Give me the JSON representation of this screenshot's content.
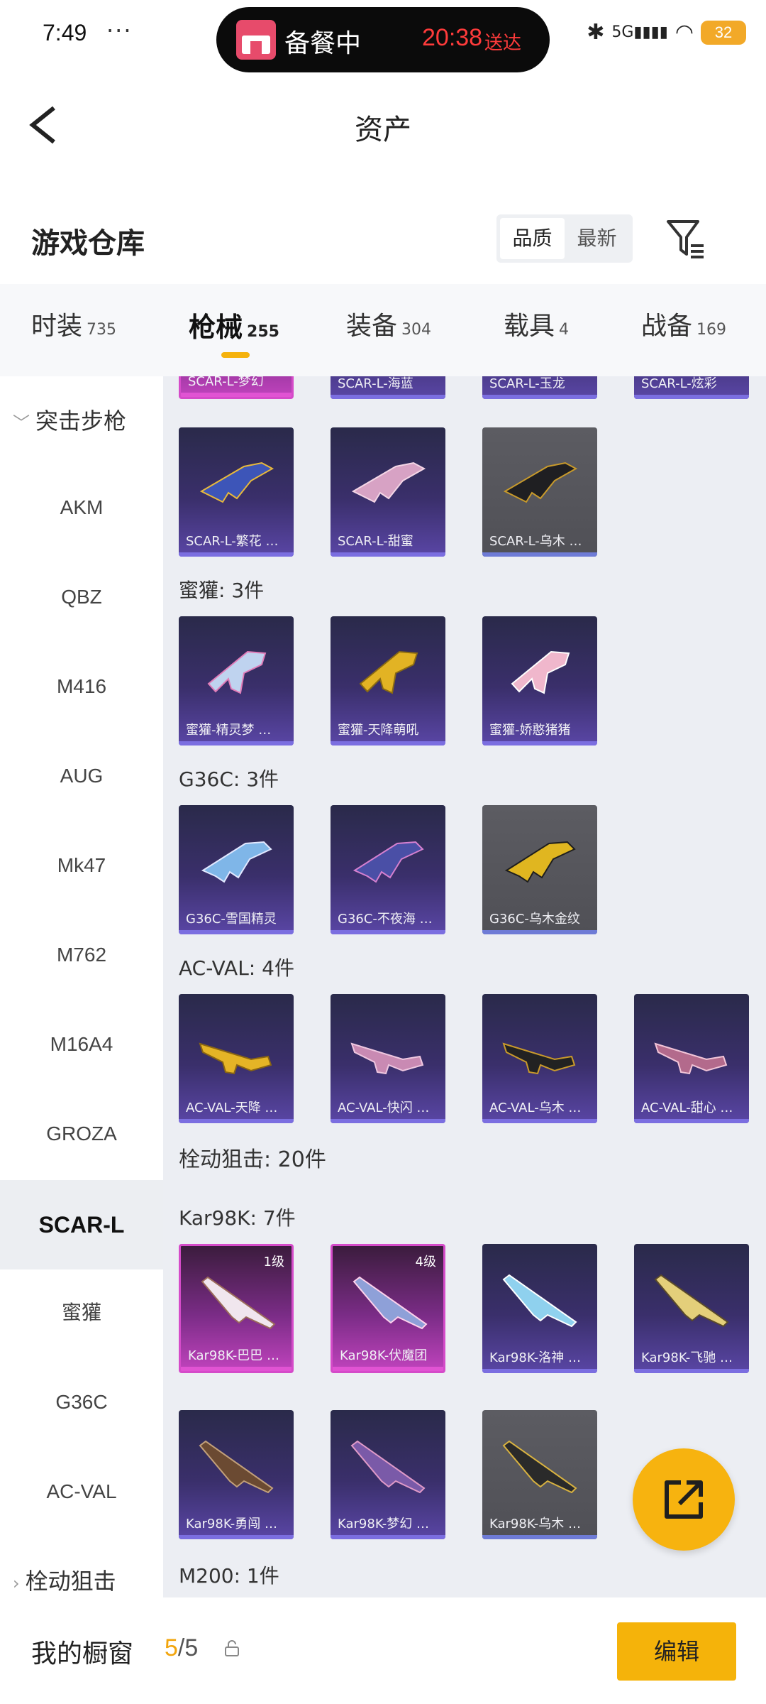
{
  "status": {
    "time": "7:49",
    "dots": "···",
    "island_title": "备餐中",
    "island_time": "20:38",
    "island_time_label": "送达",
    "network": "5G",
    "battery": "32"
  },
  "nav": {
    "title": "资产"
  },
  "warehouse": {
    "title": "游戏仓库",
    "sort": [
      "品质",
      "最新"
    ]
  },
  "tabs": [
    {
      "label": "时装",
      "count": "735"
    },
    {
      "label": "枪械",
      "count": "255"
    },
    {
      "label": "装备",
      "count": "304"
    },
    {
      "label": "载具",
      "count": "4"
    },
    {
      "label": "战备",
      "count": "169"
    }
  ],
  "sidebar": {
    "group_top": "突击步枪",
    "items": [
      "AKM",
      "QBZ",
      "M416",
      "AUG",
      "Mk47",
      "M762",
      "M16A4",
      "GROZA",
      "SCAR-L",
      "蜜獾",
      "G36C",
      "AC-VAL"
    ],
    "group_bottom": "栓动狙击"
  },
  "sections": {
    "mihuan": "蜜獾: 3件",
    "g36c": "G36C: 3件",
    "acval": "AC-VAL: 4件",
    "sniper": "栓动狙击: 20件",
    "kar98k": "Kar98K: 7件",
    "m200": "M200: 1件"
  },
  "cards": {
    "top_partial": [
      "SCAR-L-梦幻",
      "SCAR-L-海蓝",
      "SCAR-L-玉龙",
      "SCAR-L-炫彩"
    ],
    "scar": [
      "SCAR-L-繁花 …",
      "SCAR-L-甜蜜",
      "SCAR-L-乌木 …"
    ],
    "mihuan": [
      "蜜獾-精灵梦 …",
      "蜜獾-天降萌吼",
      "蜜獾-娇憨猪猪"
    ],
    "g36c": [
      "G36C-雪国精灵",
      "G36C-不夜海 …",
      "G36C-乌木金纹"
    ],
    "acval": [
      "AC-VAL-天降 …",
      "AC-VAL-快闪 …",
      "AC-VAL-乌木 …",
      "AC-VAL-甜心 …"
    ],
    "kar1": [
      "Kar98K-巴巴 …",
      "Kar98K-伏魔团",
      "Kar98K-洛神 …",
      "Kar98K-飞驰 …"
    ],
    "kar1_levels": [
      "1级",
      "4级"
    ],
    "kar2": [
      "Kar98K-勇闯 …",
      "Kar98K-梦幻 …",
      "Kar98K-乌木 …"
    ]
  },
  "bottom": {
    "label": "我的橱窗",
    "current": "5",
    "total": "/5",
    "edit": "编辑"
  },
  "colors": {
    "accent": "#f5b30a",
    "card_purple": "#3a2f6b",
    "card_pink": "#c043bd",
    "card_gray": "#55555b"
  }
}
